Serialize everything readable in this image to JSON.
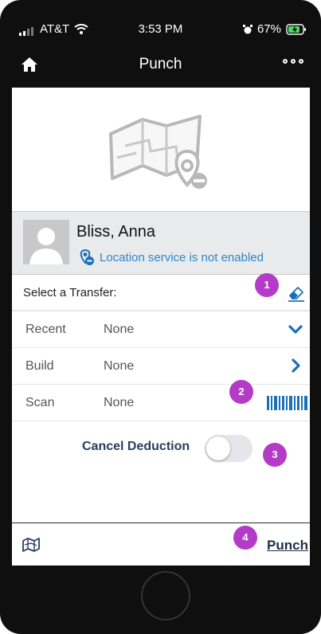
{
  "status_bar": {
    "carrier": "AT&T",
    "time": "3:53 PM",
    "battery": "67%",
    "icons": [
      "signal-icon",
      "wifi-icon",
      "alarm-icon",
      "battery-charging-icon"
    ]
  },
  "nav": {
    "title": "Punch",
    "left_icon": "home-icon",
    "right_icon": "more-dots-icon"
  },
  "user": {
    "name": "Bliss, Anna",
    "location_status": "Location service is not enabled",
    "avatar_icon": "person-icon"
  },
  "transfer": {
    "header": "Select a Transfer:",
    "clear_icon": "eraser-icon",
    "rows": [
      {
        "label": "Recent",
        "value": "None",
        "action_icon": "chevron-down-icon"
      },
      {
        "label": "Build",
        "value": "None",
        "action_icon": "chevron-right-icon"
      },
      {
        "label": "Scan",
        "value": "None",
        "action_icon": "barcode-icon"
      }
    ]
  },
  "cancel_deduction": {
    "label": "Cancel Deduction",
    "enabled": false
  },
  "footer": {
    "map_icon": "map-icon",
    "punch_label": "Punch"
  },
  "annotations": [
    "1",
    "2",
    "3",
    "4"
  ],
  "colors": {
    "accent_blue": "#1a70b8",
    "badge_purple": "#b43bc7",
    "navy_text": "#2a3e5c",
    "toggle_off": "#e5e5ea"
  }
}
